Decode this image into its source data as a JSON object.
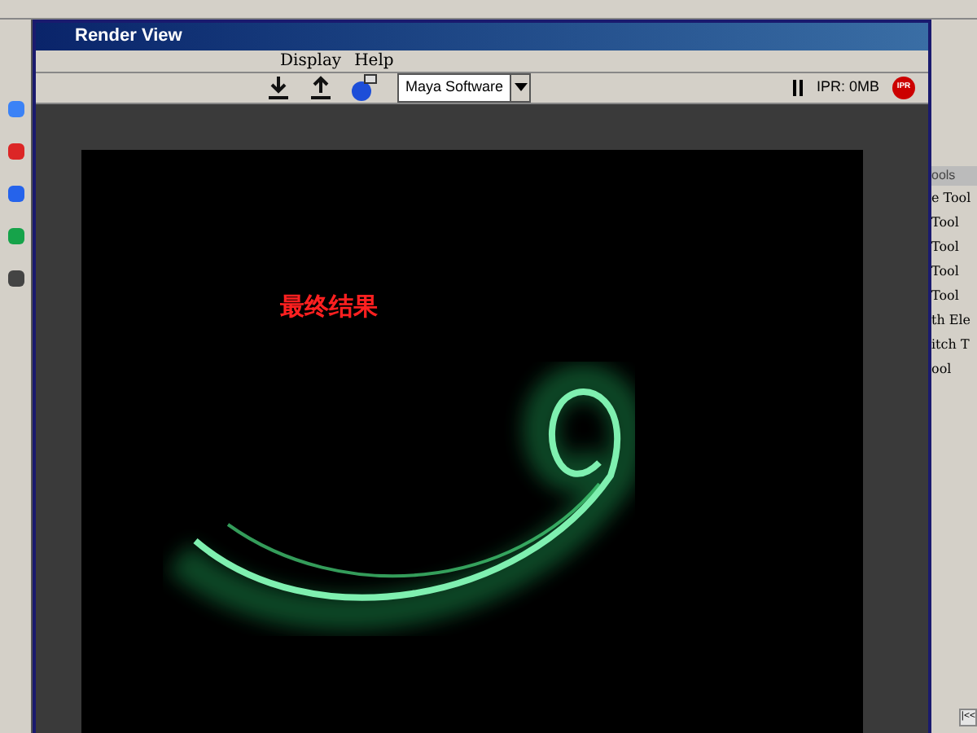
{
  "window": {
    "title": "Render View"
  },
  "menu": [
    "Display",
    "Help"
  ],
  "toolbar": {
    "renderer": "Maya Software",
    "ipr_status": "IPR: 0MB",
    "ipr_badge": "IPR"
  },
  "render": {
    "caption": "最终结果"
  },
  "side_panel": {
    "items": [
      {
        "label": "ools",
        "kind": "header"
      },
      {
        "label": "e Tool",
        "kind": "item"
      },
      {
        "label": "Tool",
        "kind": "item"
      },
      {
        "label": "Tool",
        "kind": "item"
      },
      {
        "label": "Tool",
        "kind": "item"
      },
      {
        "label": "Tool",
        "kind": "item"
      },
      {
        "label": "th Ele",
        "kind": "item"
      },
      {
        "label": "itch T",
        "kind": "item"
      },
      {
        "label": "ool",
        "kind": "item"
      }
    ],
    "button": "|<<"
  }
}
